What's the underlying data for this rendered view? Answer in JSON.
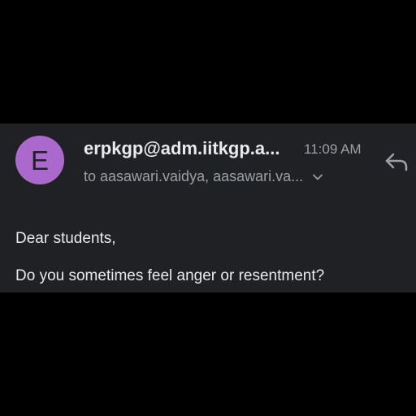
{
  "message": {
    "avatar_letter": "E",
    "avatar_color": "#ab69cd",
    "sender": "erpkgp@adm.iitkgp.a...",
    "time": "11:09 AM",
    "recipients": "to aasawari.vaidya, aasawari.va...",
    "recipients_icon": "chevron-down-icon",
    "reply_icon": "reply-icon",
    "body_greeting": "Dear students,",
    "body_line1": "Do you sometimes feel anger or resentment?"
  },
  "colors": {
    "background": "#000000",
    "panel": "#202124",
    "primary_text": "#e8eaed",
    "secondary_text": "#9aa0a6"
  }
}
